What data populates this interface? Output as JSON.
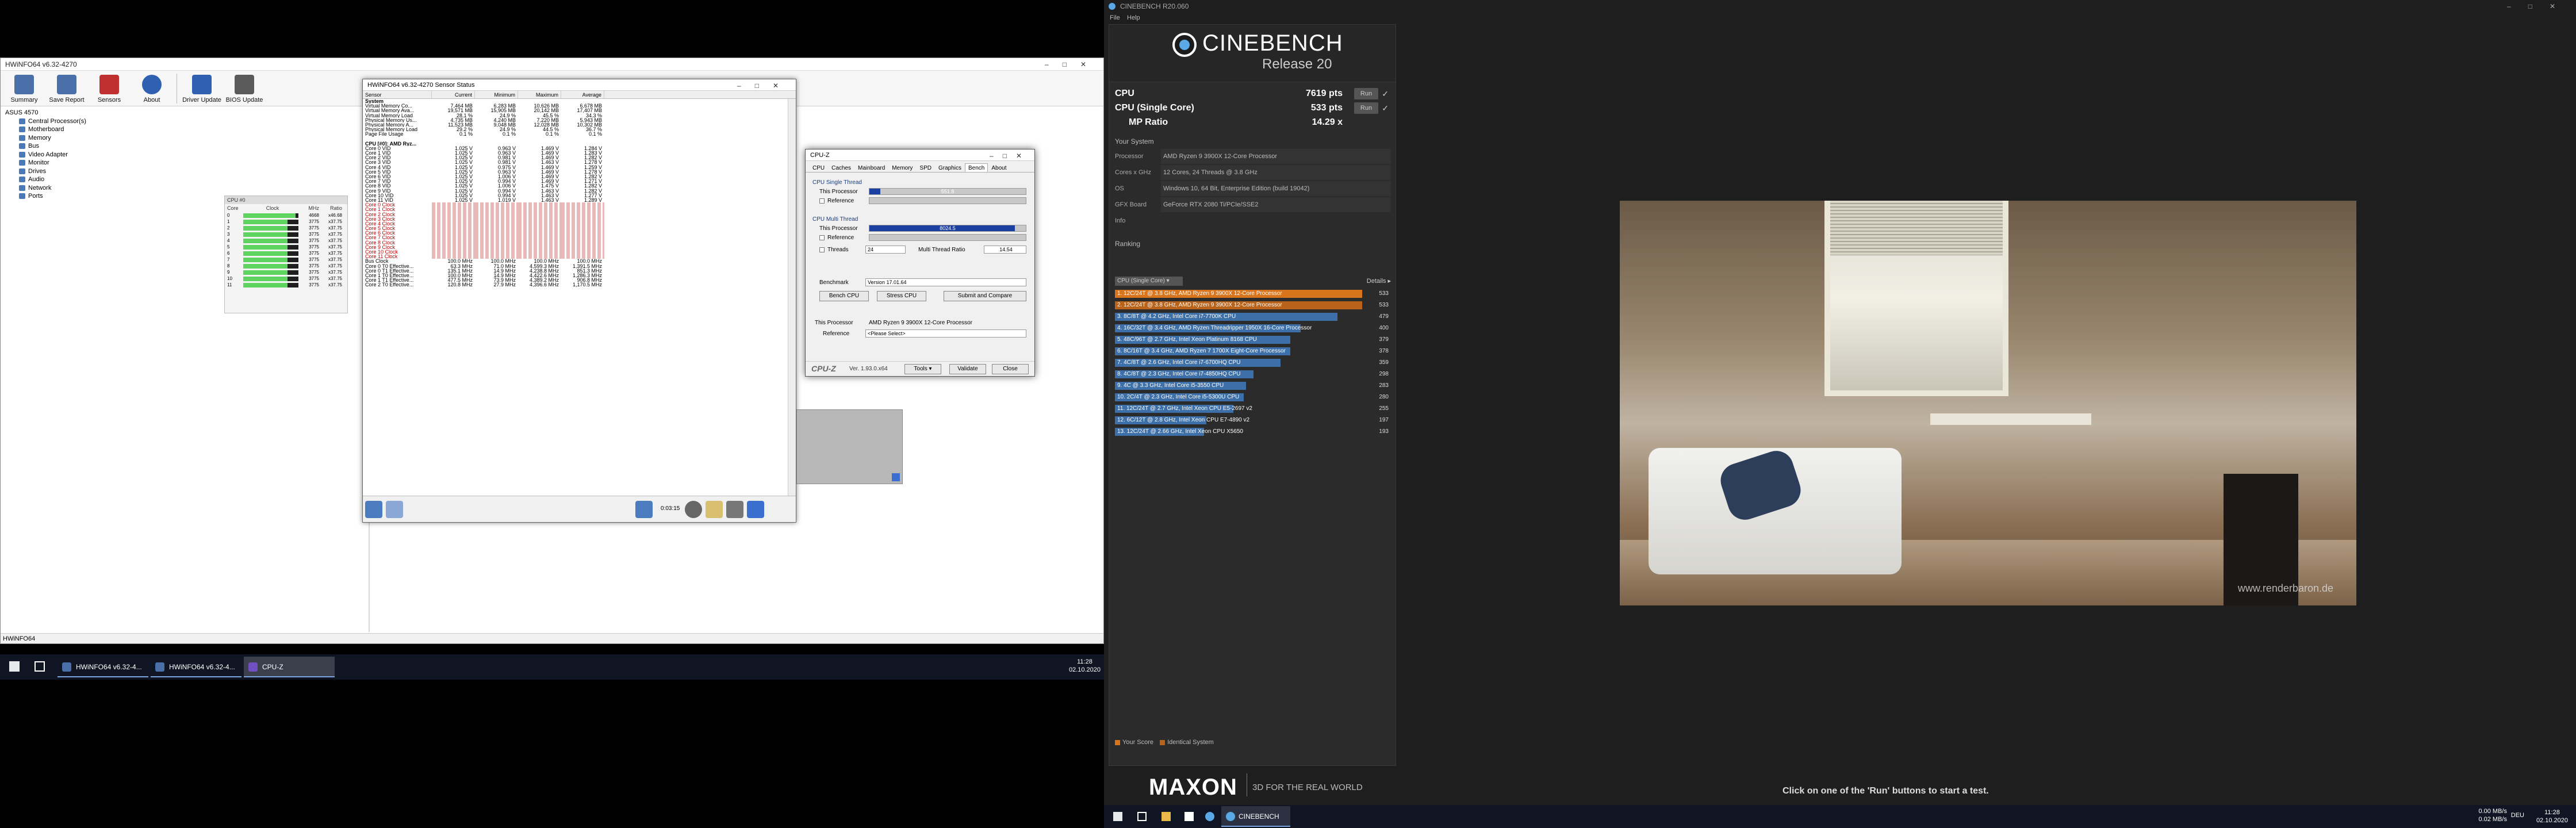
{
  "hwinfo": {
    "window_title": "HWiNFO64 v6.32-4270",
    "toolbar": [
      {
        "label": "Summary",
        "color": "#4b6fa8"
      },
      {
        "label": "Save Report",
        "color": "#4b6fa8"
      },
      {
        "label": "Sensors",
        "color": "#c03030"
      },
      {
        "label": "About",
        "color": "#3060b0"
      },
      {
        "label": "Driver Update",
        "color": "#3060b0"
      },
      {
        "label": "BIOS Update",
        "color": "#5a5a5a"
      }
    ],
    "tree_root": "ASUS 4570",
    "tree": [
      "Central Processor(s)",
      "Motherboard",
      "Memory",
      "Bus",
      "Video Adapter",
      "Monitor",
      "Drives",
      "Audio",
      "Network",
      "Ports"
    ],
    "statusbar": "HWiNFO64",
    "cpu_widget": {
      "title": "CPU #0",
      "headers": [
        "Core",
        "Clock",
        "MHz",
        "Ratio"
      ],
      "rows": [
        {
          "core": "0",
          "mhz": "4668",
          "ratio": "x46.68",
          "fill": 0.95
        },
        {
          "core": "1",
          "mhz": "3775",
          "ratio": "x37.75",
          "fill": 0.8
        },
        {
          "core": "2",
          "mhz": "3775",
          "ratio": "x37.75",
          "fill": 0.8
        },
        {
          "core": "3",
          "mhz": "3775",
          "ratio": "x37.75",
          "fill": 0.8
        },
        {
          "core": "4",
          "mhz": "3775",
          "ratio": "x37.75",
          "fill": 0.8
        },
        {
          "core": "5",
          "mhz": "3775",
          "ratio": "x37.75",
          "fill": 0.8
        },
        {
          "core": "6",
          "mhz": "3775",
          "ratio": "x37.75",
          "fill": 0.8
        },
        {
          "core": "7",
          "mhz": "3775",
          "ratio": "x37.75",
          "fill": 0.8
        },
        {
          "core": "8",
          "mhz": "3775",
          "ratio": "x37.75",
          "fill": 0.8
        },
        {
          "core": "9",
          "mhz": "3775",
          "ratio": "x37.75",
          "fill": 0.8
        },
        {
          "core": "10",
          "mhz": "3775",
          "ratio": "x37.75",
          "fill": 0.8
        },
        {
          "core": "11",
          "mhz": "3775",
          "ratio": "x37.75",
          "fill": 0.8
        }
      ]
    }
  },
  "sensor": {
    "title": "HWiNFO64 v6.32-4270 Sensor Status",
    "headers": [
      "Sensor",
      "Current",
      "Minimum",
      "Maximum",
      "Average"
    ],
    "rows": [
      {
        "t": "hdr",
        "s": "System",
        "c": "",
        "mi": "",
        "ma": "",
        "av": ""
      },
      {
        "s": "Virtual Memory Co...",
        "c": "7,464 MB",
        "mi": "6,283 MB",
        "ma": "10,626 MB",
        "av": "6,678 MB"
      },
      {
        "s": "Virtual Memory Ava...",
        "c": "19,571 MB",
        "mi": "15,905 MB",
        "ma": "20,142 MB",
        "av": "17,407 MB"
      },
      {
        "s": "Virtual Memory Load",
        "c": "28.1 %",
        "mi": "24.9 %",
        "ma": "45.5 %",
        "av": "34.3 %"
      },
      {
        "s": "Physical Memory Us...",
        "c": "4,735 MB",
        "mi": "4,240 MB",
        "ma": "7,220 MB",
        "av": "5,943 MB"
      },
      {
        "s": "Physical Memory A...",
        "c": "11,523 MB",
        "mi": "9,048 MB",
        "ma": "12,028 MB",
        "av": "10,302 MB"
      },
      {
        "s": "Physical Memory Load",
        "c": "29.2 %",
        "mi": "24.9 %",
        "ma": "44.5 %",
        "av": "36.7 %"
      },
      {
        "s": "Page File Usage",
        "c": "0.1 %",
        "mi": "0.1 %",
        "ma": "0.1 %",
        "av": "0.1 %"
      },
      {
        "t": "blank",
        "s": "",
        "c": "",
        "mi": "",
        "ma": "",
        "av": ""
      },
      {
        "t": "hdr",
        "s": "CPU [#0]: AMD Ryz...",
        "c": "",
        "mi": "",
        "ma": "",
        "av": ""
      },
      {
        "s": "Core 0 VID",
        "c": "1.025 V",
        "mi": "0.963 V",
        "ma": "1.469 V",
        "av": "1.284 V"
      },
      {
        "s": "Core 1 VID",
        "c": "1.025 V",
        "mi": "0.963 V",
        "ma": "1.469 V",
        "av": "1.283 V"
      },
      {
        "s": "Core 2 VID",
        "c": "1.025 V",
        "mi": "0.981 V",
        "ma": "1.469 V",
        "av": "1.282 V"
      },
      {
        "s": "Core 3 VID",
        "c": "1.025 V",
        "mi": "0.981 V",
        "ma": "1.463 V",
        "av": "1.278 V"
      },
      {
        "s": "Core 4 VID",
        "c": "1.025 V",
        "mi": "0.975 V",
        "ma": "1.469 V",
        "av": "1.259 V"
      },
      {
        "s": "Core 5 VID",
        "c": "1.025 V",
        "mi": "0.963 V",
        "ma": "1.469 V",
        "av": "1.278 V"
      },
      {
        "s": "Core 6 VID",
        "c": "1.025 V",
        "mi": "1.006 V",
        "ma": "1.469 V",
        "av": "1.282 V"
      },
      {
        "s": "Core 7 VID",
        "c": "1.025 V",
        "mi": "0.994 V",
        "ma": "1.469 V",
        "av": "1.271 V"
      },
      {
        "s": "Core 8 VID",
        "c": "1.025 V",
        "mi": "1.006 V",
        "ma": "1.475 V",
        "av": "1.282 V"
      },
      {
        "s": "Core 9 VID",
        "c": "1.025 V",
        "mi": "0.994 V",
        "ma": "1.463 V",
        "av": "1.282 V"
      },
      {
        "s": "Core 10 VID",
        "c": "1.025 V",
        "mi": "0.994 V",
        "ma": "1.463 V",
        "av": "1.277 V"
      },
      {
        "s": "Core 11 VID",
        "c": "1.025 V",
        "mi": "1.019 V",
        "ma": "1.463 V",
        "av": "1.289 V"
      },
      {
        "t": "red",
        "s": "Core 0 Clock",
        "c": "",
        "mi": "",
        "ma": "",
        "av": ""
      },
      {
        "t": "red",
        "s": "Core 1 Clock",
        "c": "",
        "mi": "",
        "ma": "",
        "av": ""
      },
      {
        "t": "red",
        "s": "Core 2 Clock",
        "c": "",
        "mi": "",
        "ma": "",
        "av": ""
      },
      {
        "t": "red",
        "s": "Core 3 Clock",
        "c": "",
        "mi": "",
        "ma": "",
        "av": ""
      },
      {
        "t": "red",
        "s": "Core 4 Clock",
        "c": "",
        "mi": "",
        "ma": "",
        "av": ""
      },
      {
        "t": "red",
        "s": "Core 5 Clock",
        "c": "",
        "mi": "",
        "ma": "",
        "av": ""
      },
      {
        "t": "red",
        "s": "Core 6 Clock",
        "c": "",
        "mi": "",
        "ma": "",
        "av": ""
      },
      {
        "t": "red",
        "s": "Core 7 Clock",
        "c": "",
        "mi": "",
        "ma": "",
        "av": ""
      },
      {
        "t": "red",
        "s": "Core 8 Clock",
        "c": "",
        "mi": "",
        "ma": "",
        "av": ""
      },
      {
        "t": "red",
        "s": "Core 9 Clock",
        "c": "",
        "mi": "",
        "ma": "",
        "av": ""
      },
      {
        "t": "red",
        "s": "Core 10 Clock",
        "c": "",
        "mi": "",
        "ma": "",
        "av": ""
      },
      {
        "t": "red",
        "s": "Core 11 Clock",
        "c": "",
        "mi": "",
        "ma": "",
        "av": ""
      },
      {
        "s": "Bus Clock",
        "c": "100.0 MHz",
        "mi": "100.0 MHz",
        "ma": "100.0 MHz",
        "av": "100.0 MHz"
      },
      {
        "s": "Core 0 T0 Effective...",
        "c": "63.3 MHz",
        "mi": "71.0 MHz",
        "ma": "4,599.3 MHz",
        "av": "1,391.5 MHz"
      },
      {
        "s": "Core 0 T1 Effective...",
        "c": "135.1 MHz",
        "mi": "14.9 MHz",
        "ma": "4,238.8 MHz",
        "av": "851.3 MHz"
      },
      {
        "s": "Core 1 T0 Effective...",
        "c": "100.0 MHz",
        "mi": "14.9 MHz",
        "ma": "4,422.6 MHz",
        "av": "1,286.3 MHz"
      },
      {
        "s": "Core 1 T1 Effective...",
        "c": "477.5 MHz",
        "mi": "73.9 MHz",
        "ma": "4,389.2 MHz",
        "av": "906.8 MHz"
      },
      {
        "s": "Core 2 T0 Effective...",
        "c": "120.8 MHz",
        "mi": "27.9 MHz",
        "ma": "4,396.6 MHz",
        "av": "1,170.5 MHz"
      }
    ],
    "time": "0:03:15"
  },
  "cpuz": {
    "title": "CPU-Z",
    "tabs": [
      "CPU",
      "Caches",
      "Mainboard",
      "Memory",
      "SPD",
      "Graphics",
      "Bench",
      "About"
    ],
    "active_tab": "Bench",
    "single_group": "CPU Single Thread",
    "multi_group": "CPU Multi Thread",
    "this_processor": "This Processor",
    "reference": "Reference",
    "single_value": "551.8",
    "single_fill": 0.07,
    "multi_value": "8024.5",
    "multi_fill": 0.93,
    "threads_label": "Threads",
    "threads_value": "24",
    "mt_ratio_label": "Multi Thread Ratio",
    "mt_ratio_value": "14.54",
    "benchmark_label": "Benchmark",
    "benchmark_value": "Version 17.01.64",
    "bench_cpu": "Bench CPU",
    "stress_cpu": "Stress CPU",
    "submit": "Submit and Compare",
    "this_proc_label": "This Processor",
    "this_proc_value": "AMD Ryzen 9 3900X 12-Core Processor",
    "reference_label": "Reference",
    "reference_value": "<Please Select>",
    "logo": "CPU-Z",
    "version": "Ver. 1.93.0.x64",
    "tools": "Tools",
    "validate": "Validate",
    "close": "Close"
  },
  "left_taskbar": {
    "tasks": [
      {
        "label": "HWiNFO64 v6.32-4...",
        "color": "#4b6fa8"
      },
      {
        "label": "HWiNFO64 v6.32-4...",
        "color": "#4b6fa8"
      },
      {
        "label": "CPU-Z",
        "color": "#7050c0",
        "active": true
      }
    ],
    "time": "11:28",
    "date": "02.10.2020"
  },
  "cinebench": {
    "window_title": "CINEBENCH R20.060",
    "menu": [
      "File",
      "Help"
    ],
    "logo_name": "CINEBENCH",
    "logo_release": "Release 20",
    "scores": [
      {
        "label": "CPU",
        "value": "7619 pts",
        "run": "Run"
      },
      {
        "label": "CPU (Single Core)",
        "value": "533 pts",
        "run": "Run"
      },
      {
        "label": "MP Ratio",
        "value": "14.29 x",
        "run": ""
      }
    ],
    "system_title": "Your System",
    "system": [
      {
        "k": "Processor",
        "v": "AMD Ryzen 9 3900X 12-Core Processor"
      },
      {
        "k": "Cores x GHz",
        "v": "12 Cores, 24 Threads @ 3.8 GHz"
      },
      {
        "k": "OS",
        "v": "Windows 10, 64 Bit, Enterprise Edition (build 19042)"
      },
      {
        "k": "GFX Board",
        "v": "GeForce RTX 2080 Ti/PCIe/SSE2"
      },
      {
        "k": "Info",
        "v": ""
      }
    ],
    "ranking_title": "Ranking",
    "ranking_dropdown": "CPU (Single Core)",
    "details": "Details",
    "ranking": [
      {
        "label": "1. 12C/24T @ 3.8 GHz, AMD Ryzen 9 3900X 12-Core Processor",
        "score": "533",
        "fill": 1.0,
        "color": "#d8741c"
      },
      {
        "label": "2. 12C/24T @ 3.8 GHz, AMD Ryzen 9 3900X 12-Core Processor",
        "score": "533",
        "fill": 1.0,
        "color": "#b8621a"
      },
      {
        "label": "3. 8C/8T @ 4.2 GHz, Intel Core i7-7700K CPU",
        "score": "479",
        "fill": 0.9,
        "color": "#3d6fa8"
      },
      {
        "label": "4. 16C/32T @ 3.4 GHz, AMD Ryzen Threadripper 1950X 16-Core Processor",
        "score": "400",
        "fill": 0.75,
        "color": "#3d6fa8"
      },
      {
        "label": "5. 48C/96T @ 2.7 GHz, Intel Xeon Platinum 8168 CPU",
        "score": "379",
        "fill": 0.71,
        "color": "#3d6fa8"
      },
      {
        "label": "6. 8C/16T @ 3.4 GHz, AMD Ryzen 7 1700X Eight-Core Processor",
        "score": "378",
        "fill": 0.71,
        "color": "#3d6fa8"
      },
      {
        "label": "7. 4C/8T @ 2.6 GHz, Intel Core i7-6700HQ CPU",
        "score": "359",
        "fill": 0.67,
        "color": "#3d6fa8"
      },
      {
        "label": "8. 4C/8T @ 2.3 GHz, Intel Core i7-4850HQ CPU",
        "score": "298",
        "fill": 0.56,
        "color": "#3d6fa8"
      },
      {
        "label": "9. 4C @ 3.3 GHz, Intel Core i5-3550 CPU",
        "score": "283",
        "fill": 0.53,
        "color": "#3d6fa8"
      },
      {
        "label": "10. 2C/4T @ 2.3 GHz, Intel Core i5-5300U CPU",
        "score": "280",
        "fill": 0.52,
        "color": "#3d6fa8"
      },
      {
        "label": "11. 12C/24T @ 2.7 GHz, Intel Xeon CPU E5-2697 v2",
        "score": "255",
        "fill": 0.48,
        "color": "#3d6fa8"
      },
      {
        "label": "12. 6C/12T @ 2.8 GHz, Intel Xeon CPU E7-4890 v2",
        "score": "197",
        "fill": 0.37,
        "color": "#3d6fa8"
      },
      {
        "label": "13. 12C/24T @ 2.66 GHz, Intel Xeon CPU X5650",
        "score": "193",
        "fill": 0.36,
        "color": "#3d6fa8"
      }
    ],
    "legend_your": "Your Score",
    "legend_identical": "Identical System",
    "maxon": "MAXON",
    "maxon_tag": "3D FOR THE REAL WORLD",
    "watermark": "www.renderbaron.de",
    "hint": "Click on one of the 'Run' buttons to start a test."
  },
  "right_taskbar": {
    "app": "CINEBENCH R20.060",
    "tray_up": "0.00 MB/s",
    "tray_down": "0.02 MB/s",
    "lang": "DEU",
    "time": "11:28",
    "date": "02.10.2020"
  }
}
